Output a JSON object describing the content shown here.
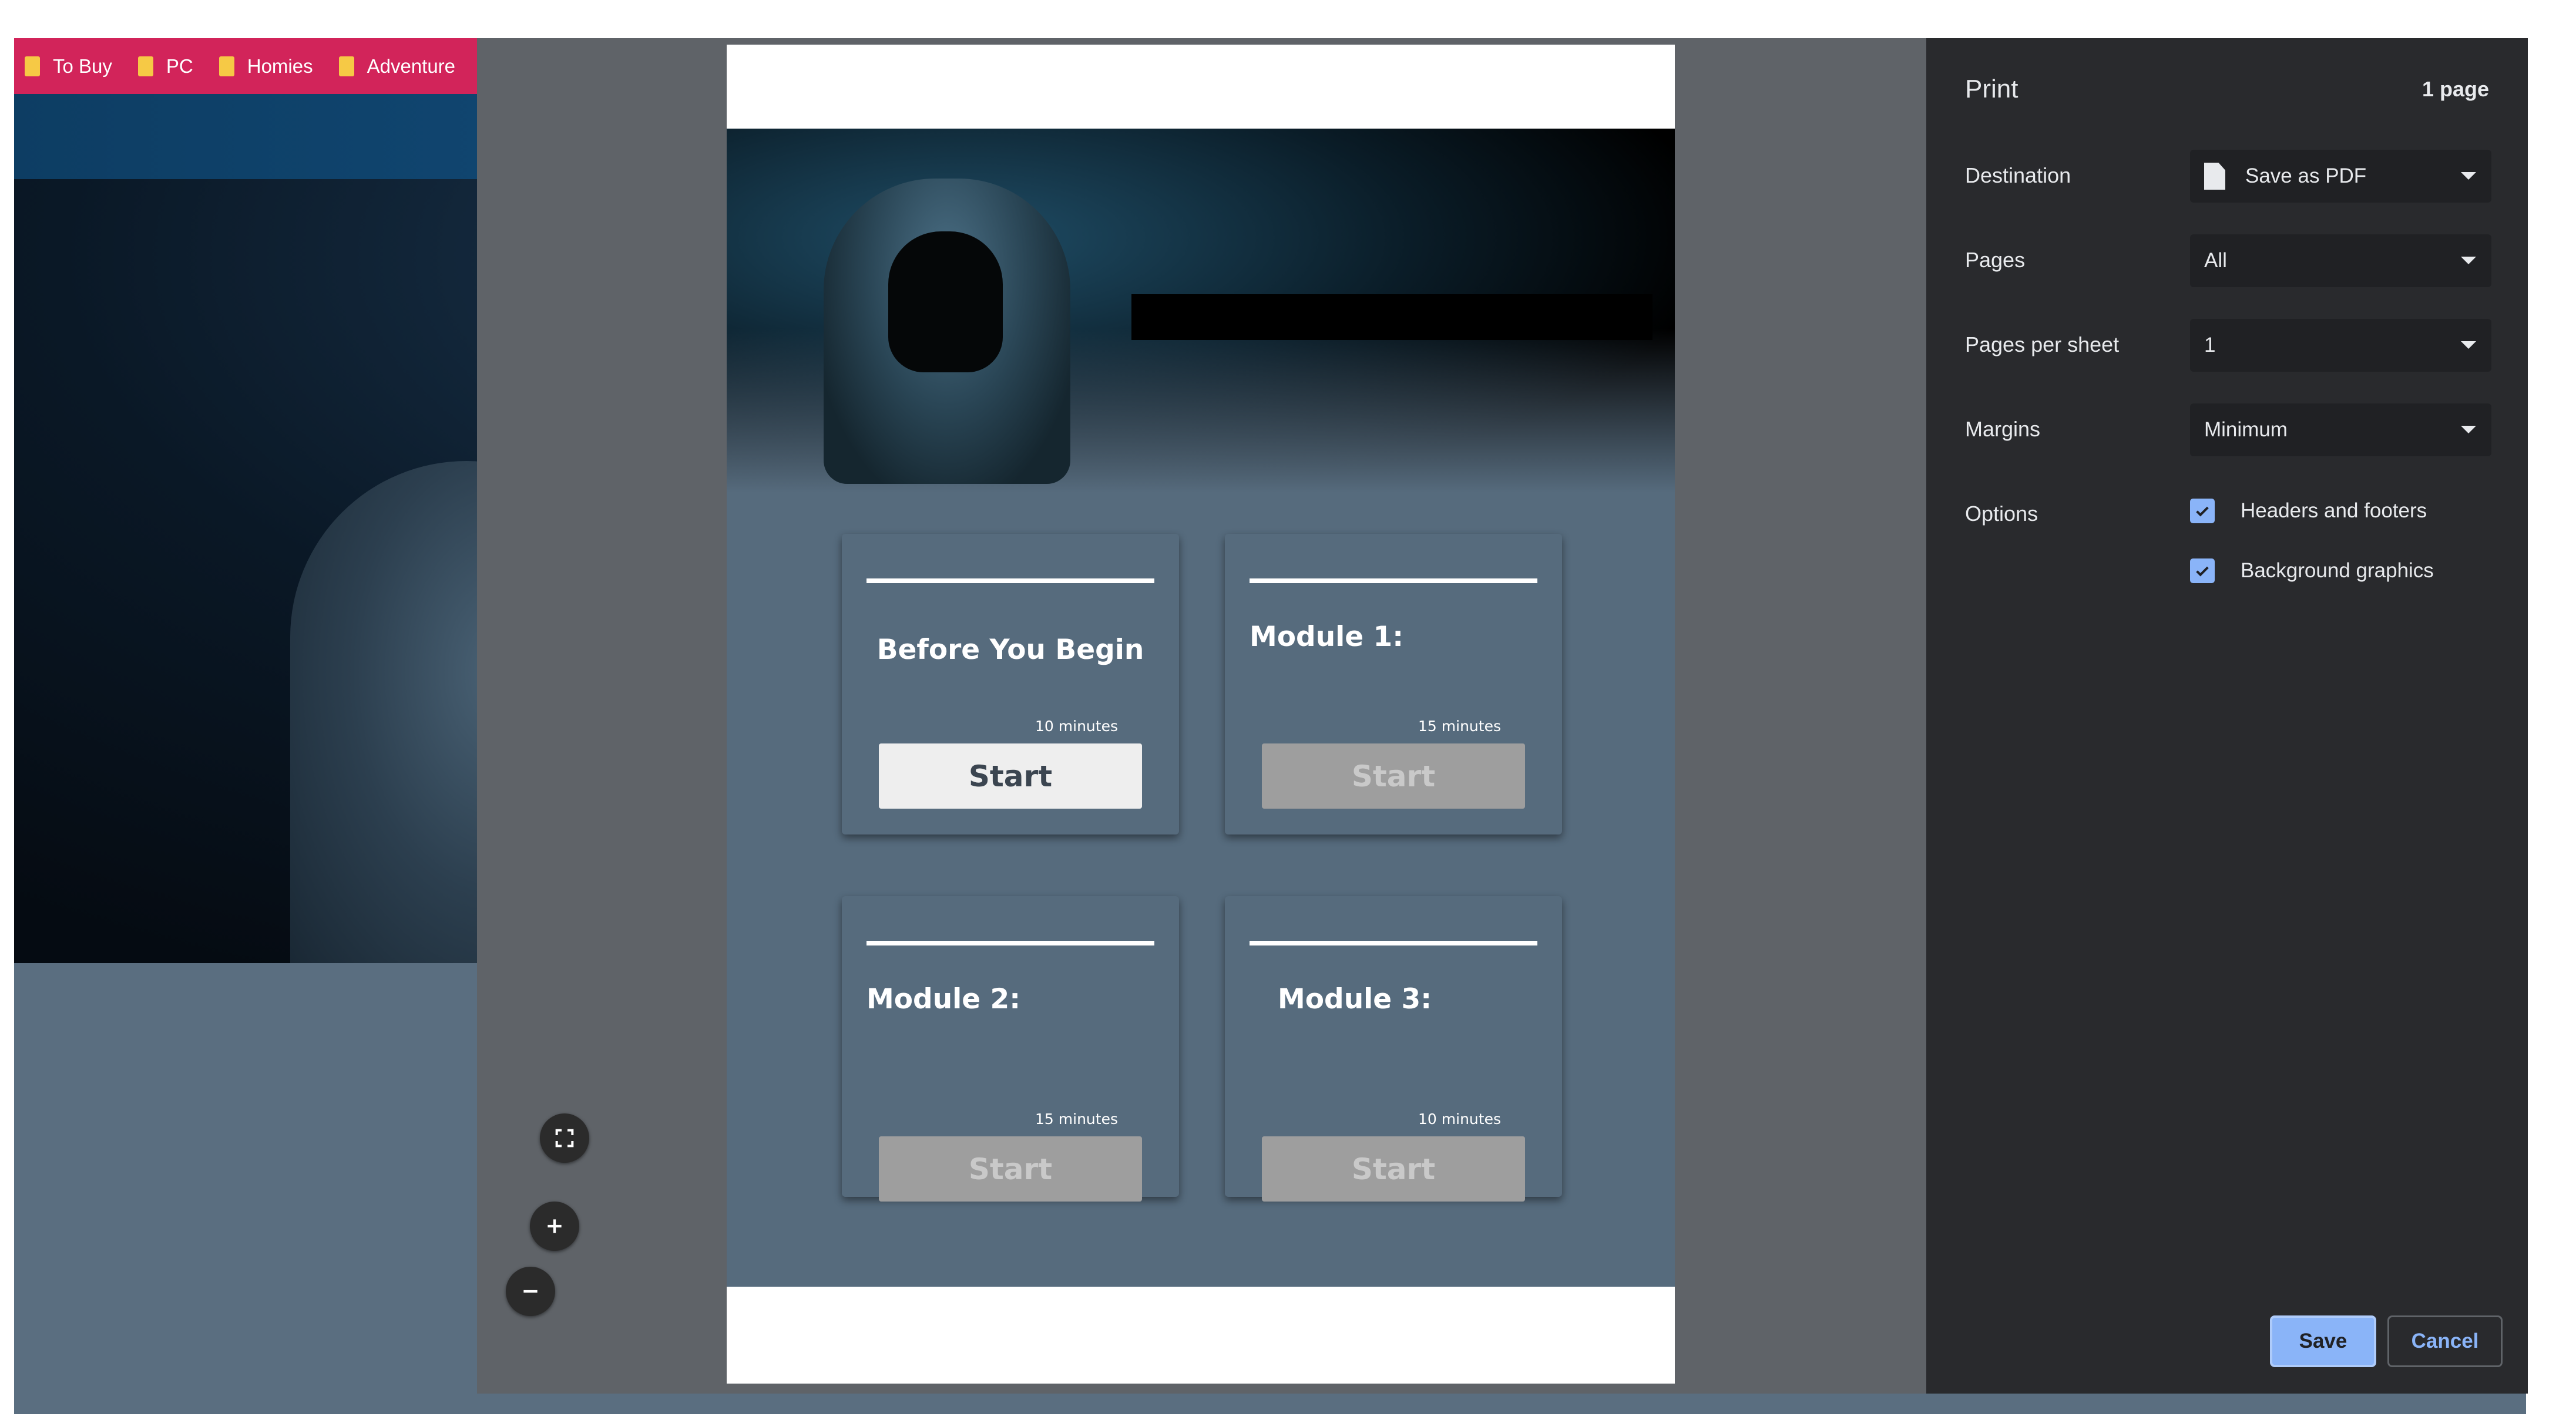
{
  "bookmarks": [
    {
      "label": "To Buy",
      "icon": "folder-icon"
    },
    {
      "label": "PC",
      "icon": "folder-icon"
    },
    {
      "label": "Homies",
      "icon": "folder-icon"
    },
    {
      "label": "Adventure",
      "icon": "folder-icon"
    }
  ],
  "preview": {
    "cards": [
      {
        "title": "Before You Begin",
        "duration": "10 minutes",
        "button": "Start",
        "enabled": true
      },
      {
        "title": "Module 1:",
        "duration": "15 minutes",
        "button": "Start",
        "enabled": false
      },
      {
        "title": "Module 2:",
        "duration": "15 minutes",
        "button": "Start",
        "enabled": false
      },
      {
        "title": "Module 3:",
        "duration": "10 minutes",
        "button": "Start",
        "enabled": false
      }
    ],
    "controls": {
      "fit_icon": "fit-to-page-icon",
      "zoom_in_icon": "zoom-in-icon",
      "zoom_out_icon": "zoom-out-icon"
    }
  },
  "print": {
    "title": "Print",
    "page_count": "1 page",
    "destination": {
      "label": "Destination",
      "value": "Save as PDF",
      "icon": "file-icon"
    },
    "pages": {
      "label": "Pages",
      "value": "All"
    },
    "pages_per_sheet": {
      "label": "Pages per sheet",
      "value": "1"
    },
    "margins": {
      "label": "Margins",
      "value": "Minimum"
    },
    "options": {
      "label": "Options",
      "headers_footers": {
        "label": "Headers and footers",
        "checked": true
      },
      "background_graphics": {
        "label": "Background graphics",
        "checked": true
      }
    },
    "save_label": "Save",
    "cancel_label": "Cancel"
  },
  "colors": {
    "bookmark_bar": "#d2245a",
    "sidebar_bg": "#292a2d",
    "accent": "#8ab4f8",
    "page_bg": "#566b7d"
  }
}
